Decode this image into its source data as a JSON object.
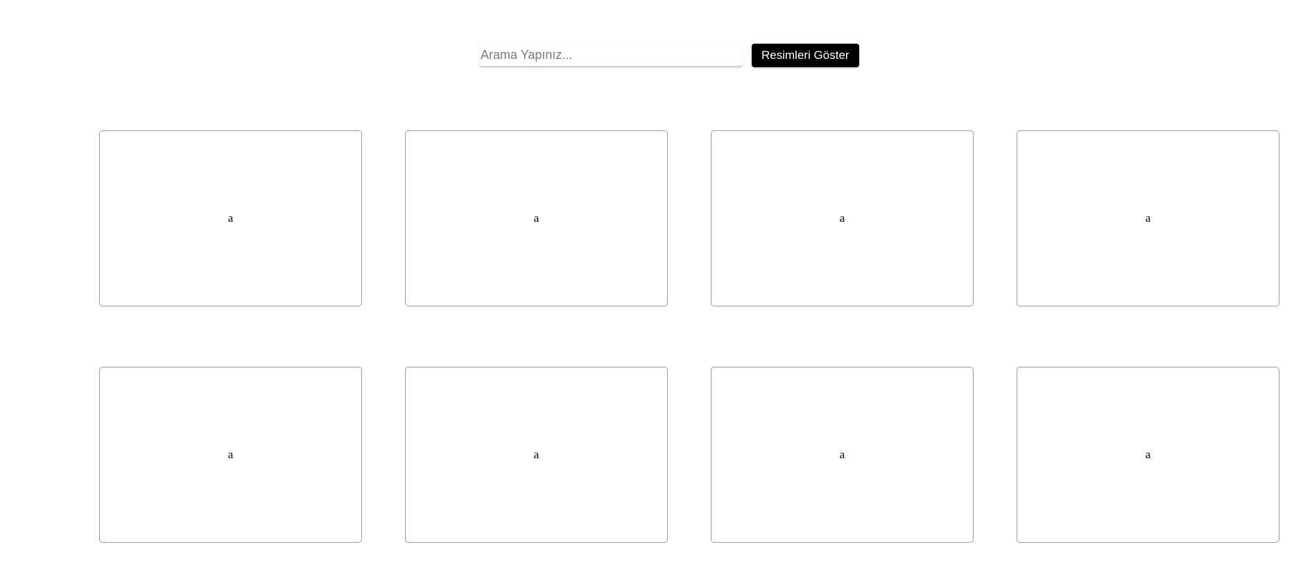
{
  "search": {
    "placeholder": "Arama Yapınız...",
    "value": "",
    "button_label": "Resimleri Göster"
  },
  "gallery": {
    "items": [
      {
        "label": "a"
      },
      {
        "label": "a"
      },
      {
        "label": "a"
      },
      {
        "label": "a"
      },
      {
        "label": "a"
      },
      {
        "label": "a"
      },
      {
        "label": "a"
      },
      {
        "label": "a"
      }
    ]
  },
  "colors": {
    "button_bg": "#000000",
    "button_text": "#ffffff",
    "card_border": "#9a9a9a"
  }
}
